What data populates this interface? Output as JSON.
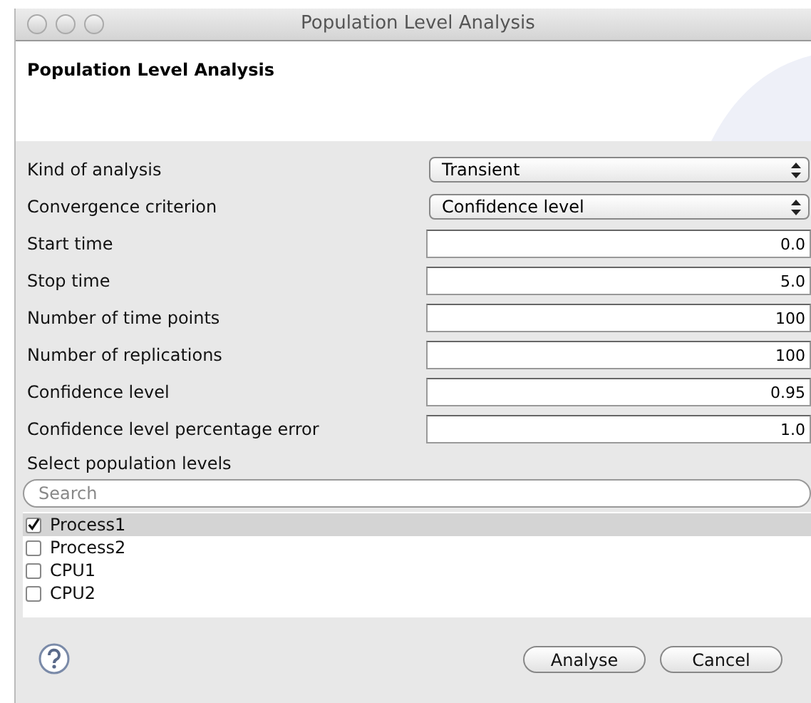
{
  "window": {
    "title": "Population Level Analysis"
  },
  "header": {
    "title": "Population Level Analysis"
  },
  "fields": [
    {
      "kind": "select",
      "label": "Kind of analysis",
      "value": "Transient"
    },
    {
      "kind": "select",
      "label": "Convergence criterion",
      "value": "Confidence level"
    },
    {
      "kind": "text",
      "label": "Start time",
      "value": "0.0"
    },
    {
      "kind": "text",
      "label": "Stop time",
      "value": "5.0"
    },
    {
      "kind": "text",
      "label": "Number of time points",
      "value": "100"
    },
    {
      "kind": "text",
      "label": "Number of replications",
      "value": "100"
    },
    {
      "kind": "text",
      "label": "Confidence level",
      "value": "0.95"
    },
    {
      "kind": "text",
      "label": "Confidence level percentage error",
      "value": "1.0"
    }
  ],
  "population": {
    "label": "Select population levels",
    "search": {
      "placeholder": "Search"
    },
    "items": [
      {
        "label": "Process1",
        "checked": true,
        "selected": true
      },
      {
        "label": "Process2",
        "checked": false,
        "selected": false
      },
      {
        "label": "CPU1",
        "checked": false,
        "selected": false
      },
      {
        "label": "CPU2",
        "checked": false,
        "selected": false
      }
    ]
  },
  "buttons": [
    "Analyse",
    "Cancel"
  ]
}
